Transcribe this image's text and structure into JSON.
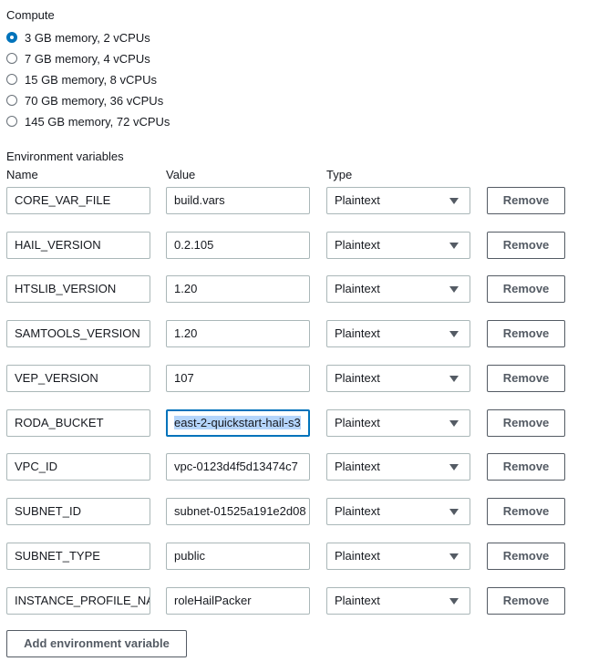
{
  "compute": {
    "label": "Compute",
    "options": [
      {
        "label": "3 GB memory, 2 vCPUs",
        "checked": true
      },
      {
        "label": "7 GB memory, 4 vCPUs",
        "checked": false
      },
      {
        "label": "15 GB memory, 8 vCPUs",
        "checked": false
      },
      {
        "label": "70 GB memory, 36 vCPUs",
        "checked": false
      },
      {
        "label": "145 GB memory, 72 vCPUs",
        "checked": false
      }
    ]
  },
  "env": {
    "label": "Environment variables",
    "headers": {
      "name": "Name",
      "value": "Value",
      "type": "Type"
    },
    "remove_label": "Remove",
    "add_label": "Add environment variable",
    "rows": [
      {
        "name": "CORE_VAR_FILE",
        "value": "build.vars",
        "type": "Plaintext"
      },
      {
        "name": "HAIL_VERSION",
        "value": "0.2.105",
        "type": "Plaintext"
      },
      {
        "name": "HTSLIB_VERSION",
        "value": "1.20",
        "type": "Plaintext"
      },
      {
        "name": "SAMTOOLS_VERSION",
        "value": "1.20",
        "type": "Plaintext"
      },
      {
        "name": "VEP_VERSION",
        "value": "107",
        "type": "Plaintext"
      },
      {
        "name": "RODA_BUCKET",
        "value": "east-2-quickstart-hail-s3",
        "type": "Plaintext",
        "focused": true
      },
      {
        "name": "VPC_ID",
        "value": "vpc-0123d4f5d13474c7",
        "type": "Plaintext"
      },
      {
        "name": "SUBNET_ID",
        "value": "subnet-01525a191e2d08",
        "type": "Plaintext"
      },
      {
        "name": "SUBNET_TYPE",
        "value": "public",
        "type": "Plaintext"
      },
      {
        "name": "INSTANCE_PROFILE_NAM",
        "value": "roleHailPacker",
        "type": "Plaintext"
      }
    ]
  },
  "colors": {
    "accent": "#0073bb",
    "border": "#aab7b8",
    "button_text": "#545b64",
    "selection": "#b5d5fb"
  }
}
